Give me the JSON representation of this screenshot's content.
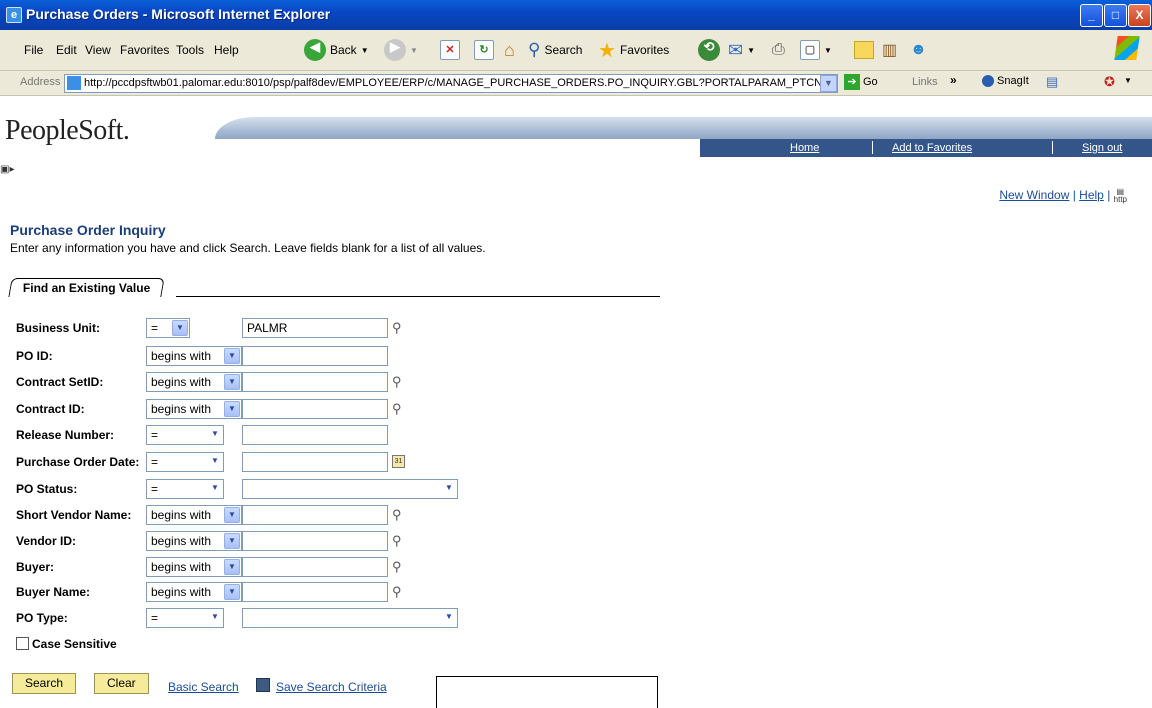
{
  "window": {
    "title": "Purchase Orders - Microsoft Internet Explorer",
    "min": "_",
    "max": "□",
    "close": "X"
  },
  "menu": [
    "File",
    "Edit",
    "View",
    "Favorites",
    "Tools",
    "Help"
  ],
  "toolbar": {
    "back": "Back",
    "search": "Search",
    "favorites": "Favorites"
  },
  "address": {
    "label": "Address",
    "url": "http://pccdpsftwb01.palomar.edu:8010/psp/palf8dev/EMPLOYEE/ERP/c/MANAGE_PURCHASE_ORDERS.PO_INQUIRY.GBL?PORTALPARAM_PTCN",
    "go": "Go",
    "links": "Links",
    "snagit": "SnagIt"
  },
  "ps": {
    "logo": "PeopleSoft.",
    "nav": {
      "home": "Home",
      "add_favorites": "Add to Favorites",
      "signout": "Sign out"
    },
    "new_window": "New Window",
    "help": "Help",
    "http_icon": "http"
  },
  "page": {
    "title": "Purchase Order Inquiry",
    "instructions": "Enter any information you have and click Search. Leave fields blank for a list of all values.",
    "tab": "Find an Existing Value"
  },
  "fields": [
    {
      "label": "Business Unit:",
      "op": "=",
      "value": "PALMR"
    },
    {
      "label": "PO ID:",
      "op": "begins with",
      "value": ""
    },
    {
      "label": "Contract SetID:",
      "op": "begins with",
      "value": ""
    },
    {
      "label": "Contract ID:",
      "op": "begins with",
      "value": ""
    },
    {
      "label": "Release Number:",
      "op": "=",
      "value": ""
    },
    {
      "label": "Purchase Order Date:",
      "op": "=",
      "value": ""
    },
    {
      "label": "PO Status:",
      "op": "=",
      "value": ""
    },
    {
      "label": "Short Vendor Name:",
      "op": "begins with",
      "value": ""
    },
    {
      "label": "Vendor ID:",
      "op": "begins with",
      "value": ""
    },
    {
      "label": "Buyer:",
      "op": "begins with",
      "value": ""
    },
    {
      "label": "Buyer Name:",
      "op": "begins with",
      "value": ""
    },
    {
      "label": "PO Type:",
      "op": "=",
      "value": ""
    }
  ],
  "case_sensitive": "Case Sensitive",
  "buttons": {
    "search": "Search",
    "clear": "Clear",
    "basic_search": "Basic Search",
    "save_criteria": "Save Search Criteria"
  },
  "colors": {
    "title_bar": "#0846c4",
    "page_title": "#1b3d7a",
    "link": "#1b4c9b",
    "button": "#f6eb9a",
    "nav_band": "#33558a"
  }
}
